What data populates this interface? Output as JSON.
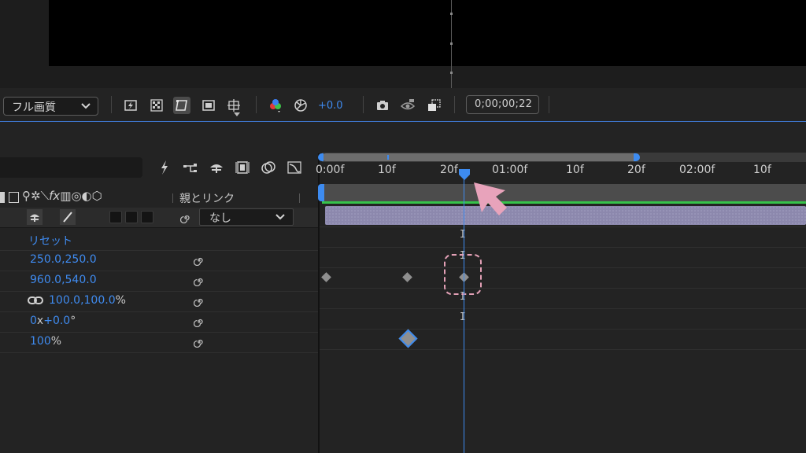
{
  "toolbar": {
    "quality_label": "フル画質",
    "exposure_value": "+0.0",
    "timecode": "0;00;00;22"
  },
  "timeline": {
    "ruler_labels": [
      "0:00f",
      "10f",
      "20f",
      "01:00f",
      "10f",
      "20f",
      "02:00f",
      "10f"
    ],
    "column_header_parent_link": "親とリンク",
    "layer": {
      "parent_value": "なし"
    },
    "properties": [
      {
        "name": "reset",
        "value": "リセット"
      },
      {
        "name": "anchor-point",
        "value": "250.0,250.0"
      },
      {
        "name": "position",
        "value": "960.0,540.0"
      },
      {
        "name": "scale",
        "value": "100.0,100.0",
        "unit": "%"
      },
      {
        "name": "rotation",
        "value": "0",
        "mid": "x",
        "value2": "+0.0",
        "unit": "°"
      },
      {
        "name": "opacity",
        "value": "100",
        "unit": "%"
      }
    ]
  },
  "colors": {
    "accent": "#3f8bf0",
    "green": "#36c24a",
    "layer_bar": "#8c88ad",
    "highlight": "#e3a0b6",
    "pointer": "#e8a3bb"
  },
  "icons": [
    "chevron-down-icon",
    "fast-preview-icon",
    "transparency-grid-icon",
    "mask-path-icon",
    "region-of-interest-icon",
    "safe-margins-icon",
    "color-channel-icon",
    "exposure-reset-icon",
    "snapshot-camera-icon",
    "show-snapshot-icon",
    "3d-view-icon",
    "draft-3d-icon",
    "motion-blur-icon",
    "frame-blending-icon",
    "graph-editor-icon",
    "keyframe-icon",
    "spiral-pickwhip-icon",
    "chain-link-icon",
    "pointer-arrow-icon"
  ]
}
